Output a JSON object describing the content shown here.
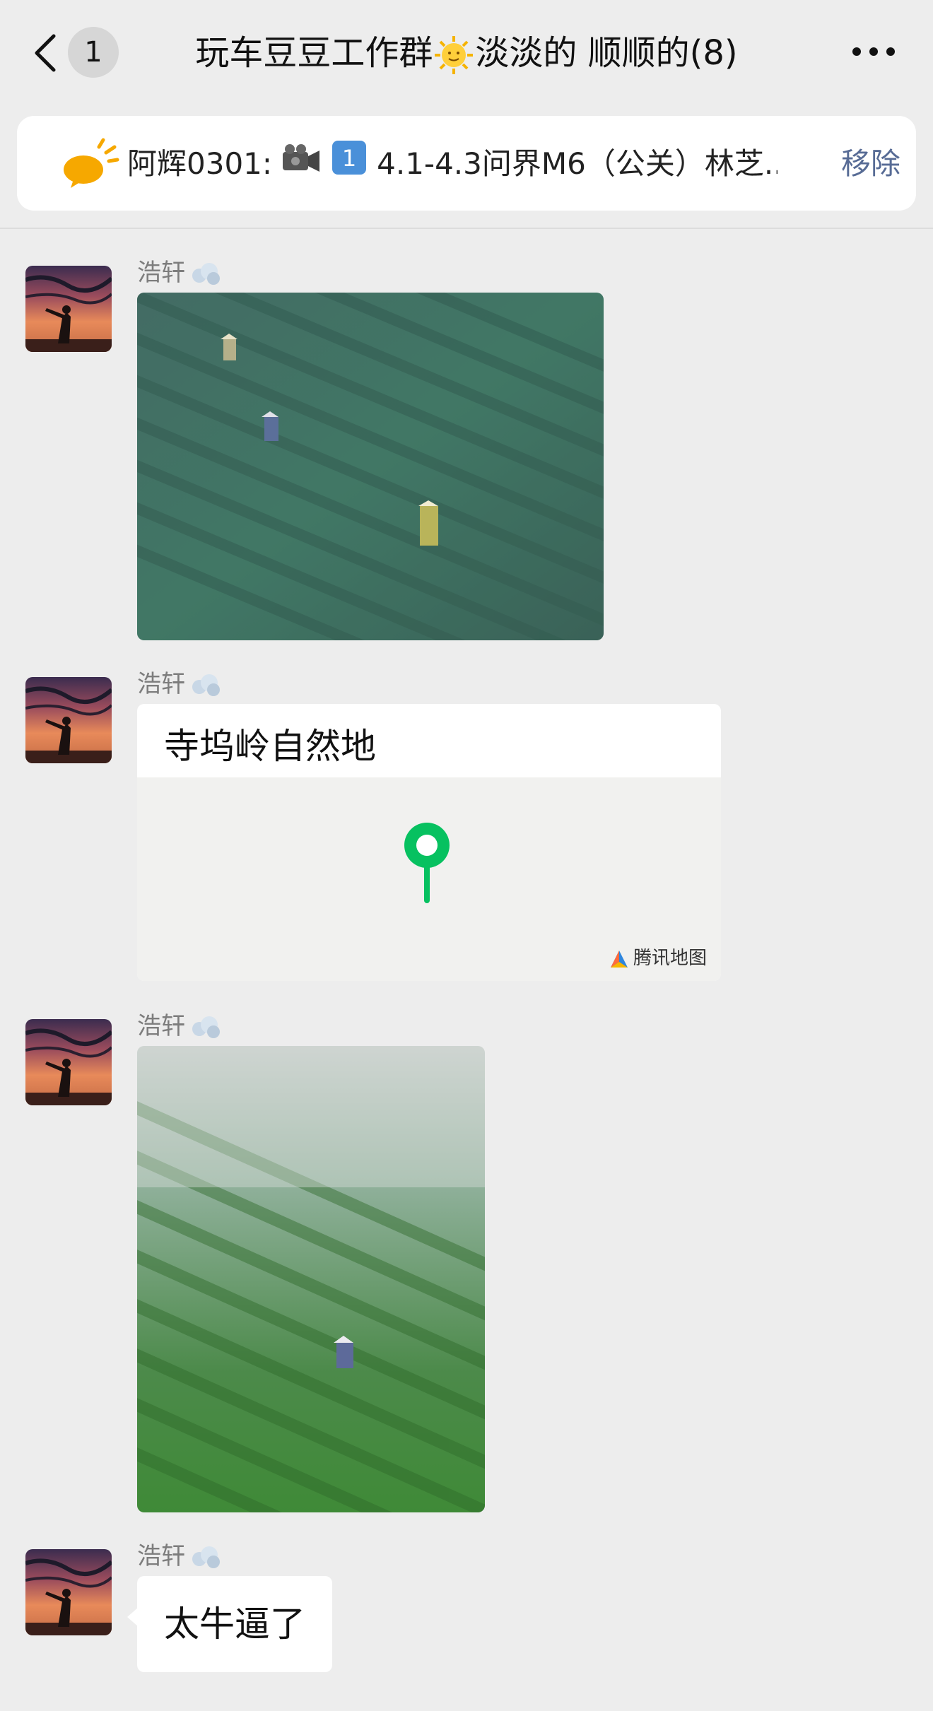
{
  "header": {
    "back_badge": "1",
    "title_part1": "玩车豆豆工作群",
    "title_emoji": "sun-with-face-emoji",
    "title_part2": "淡淡的 顺顺的(8)",
    "more_icon": "more-icon"
  },
  "pinned": {
    "icon": "speech-bubble-sun-icon",
    "sender": "阿辉0301:",
    "emoji_1": "video-camera-emoji",
    "emoji_2": "keycap-1-emoji",
    "text": "4.1-4.3问界M6（公关）林芝...",
    "remove_label": "移除"
  },
  "messages": [
    {
      "sender": "浩轩",
      "sender_emoji": "dash-emoji",
      "type": "image",
      "image_desc_icon": "tea-field-photo"
    },
    {
      "sender": "浩轩",
      "sender_emoji": "dash-emoji",
      "type": "location",
      "location_name": "寺坞岭自然地",
      "map_brand": "腾讯地图"
    },
    {
      "sender": "浩轩",
      "sender_emoji": "dash-emoji",
      "type": "image",
      "image_desc_icon": "tea-field-photo"
    },
    {
      "sender": "浩轩",
      "sender_emoji": "dash-emoji",
      "type": "text",
      "text": "太牛逼了"
    }
  ],
  "colors": {
    "background": "#ededed",
    "link_blue": "#576b95",
    "pin_green": "#07c160"
  }
}
